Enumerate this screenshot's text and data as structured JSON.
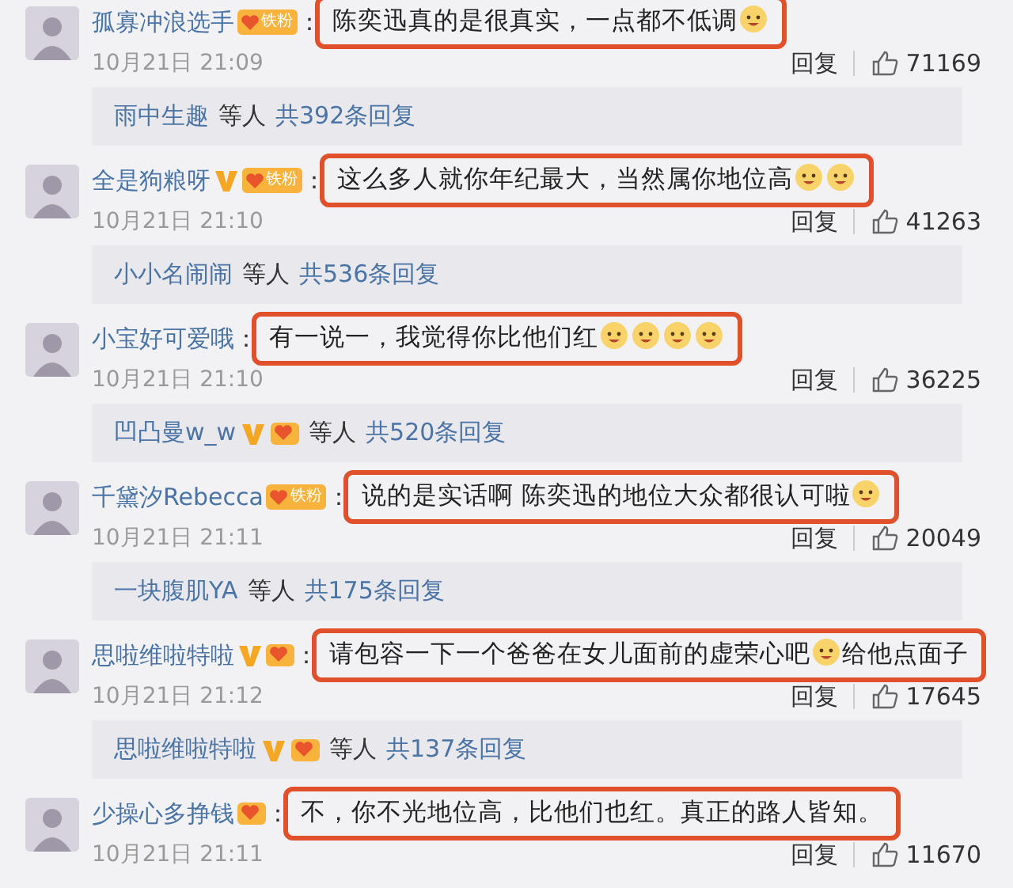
{
  "comments": [
    {
      "user": "孤寡冲浪选手",
      "badges": [
        {
          "kind": "fan",
          "label": "铁粉"
        }
      ],
      "separator": "：",
      "content": [
        {
          "kind": "text",
          "text": "陈奕迅真的是很真实，一点都不低调"
        },
        {
          "kind": "emoji"
        }
      ],
      "highlighted": true,
      "time": "10月21日 21:09",
      "reply_label": "回复",
      "likes": "71169",
      "thread": {
        "user": "雨中生趣",
        "suffix": "等人",
        "count": "共392条回复"
      }
    },
    {
      "user": "全是狗粮呀",
      "badges": [
        {
          "kind": "v"
        },
        {
          "kind": "fan",
          "label": "铁粉"
        }
      ],
      "separator": "：",
      "content": [
        {
          "kind": "text",
          "text": "这么多人就你年纪最大，当然属你地位高"
        },
        {
          "kind": "emoji"
        },
        {
          "kind": "emoji"
        }
      ],
      "highlighted": true,
      "time": "10月21日 21:10",
      "reply_label": "回复",
      "likes": "41263",
      "thread": {
        "user": "小小名闹闹",
        "suffix": "等人",
        "count": "共536条回复"
      }
    },
    {
      "user": "小宝好可爱哦",
      "separator": "：",
      "content": [
        {
          "kind": "text",
          "text": "有一说一，我觉得你比他们红"
        },
        {
          "kind": "emoji"
        },
        {
          "kind": "emoji"
        },
        {
          "kind": "emoji"
        },
        {
          "kind": "emoji"
        }
      ],
      "highlighted": true,
      "time": "10月21日 21:10",
      "reply_label": "回复",
      "likes": "36225",
      "thread": {
        "user": "凹凸曼w_w",
        "badges": [
          {
            "kind": "v"
          },
          {
            "kind": "fan"
          }
        ],
        "suffix": "等人",
        "count": "共520条回复"
      }
    },
    {
      "user": "千黛汐Rebecca",
      "badges": [
        {
          "kind": "fan",
          "label": "铁粉"
        }
      ],
      "separator": "：",
      "content": [
        {
          "kind": "text",
          "text": "说的是实话啊 陈奕迅的地位大众都很认可啦"
        },
        {
          "kind": "emoji"
        }
      ],
      "highlighted": true,
      "time": "10月21日 21:11",
      "reply_label": "回复",
      "likes": "20049",
      "thread": {
        "user": "一块腹肌YA",
        "suffix": "等人",
        "count": "共175条回复"
      }
    },
    {
      "user": "思啦维啦特啦",
      "badges": [
        {
          "kind": "v"
        },
        {
          "kind": "fan"
        }
      ],
      "separator": "：",
      "content": [
        {
          "kind": "text",
          "text": "请包容一下一个爸爸在女儿面前的虚荣心吧"
        },
        {
          "kind": "emoji"
        },
        {
          "kind": "text",
          "text": "给他点面子"
        }
      ],
      "highlighted": true,
      "time": "10月21日 21:12",
      "reply_label": "回复",
      "likes": "17645",
      "thread": {
        "user": "思啦维啦特啦",
        "badges": [
          {
            "kind": "v"
          },
          {
            "kind": "fan"
          }
        ],
        "suffix": "等人",
        "count": "共137条回复"
      }
    },
    {
      "user": "少操心多挣钱",
      "badges": [
        {
          "kind": "fan"
        }
      ],
      "separator": "：",
      "content": [
        {
          "kind": "text",
          "text": "不，你不光地位高，比他们也红。真正的路人皆知。"
        }
      ],
      "highlighted": true,
      "time": "10月21日 21:11",
      "reply_label": "回复",
      "likes": "11670"
    }
  ]
}
